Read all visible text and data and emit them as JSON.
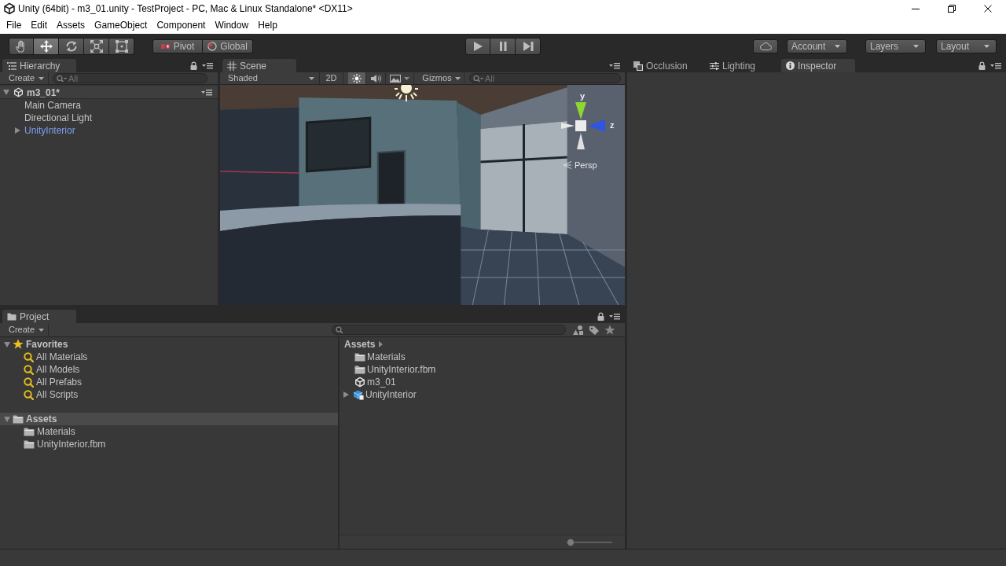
{
  "window": {
    "title": "Unity (64bit) - m3_01.unity - TestProject - PC, Mac & Linux Standalone* <DX11>"
  },
  "menu": [
    "File",
    "Edit",
    "Assets",
    "GameObject",
    "Component",
    "Window",
    "Help"
  ],
  "toolbar": {
    "tools": [
      {
        "kind": "hand",
        "selected": false
      },
      {
        "kind": "move",
        "selected": true
      },
      {
        "kind": "rotate",
        "selected": false
      },
      {
        "kind": "scale",
        "selected": false
      },
      {
        "kind": "rect",
        "selected": false
      }
    ],
    "handle_position": "Pivot",
    "handle_rotation": "Global",
    "playback": [
      {
        "kind": "play"
      },
      {
        "kind": "pause"
      },
      {
        "kind": "step"
      }
    ],
    "account": "Account",
    "layers": "Layers",
    "layout": "Layout"
  },
  "hierarchy": {
    "tab": "Hierarchy",
    "create": "Create",
    "search": {
      "placeholder": "All"
    },
    "scene": {
      "name": "m3_01*",
      "expanded": true,
      "selected": false,
      "children": [
        {
          "name": "Main Camera",
          "kind": "object",
          "selected": false
        },
        {
          "name": "Directional Light",
          "kind": "object",
          "selected": false
        },
        {
          "name": "UnityInterior",
          "kind": "prefab",
          "selected": false,
          "expanded": false
        }
      ]
    }
  },
  "scene_view": {
    "tab": "Scene",
    "draw_mode": "Shaded",
    "toggles": [
      {
        "kind": "flat",
        "label": "2D",
        "on": false
      },
      {
        "kind": "lighting",
        "on": true
      },
      {
        "kind": "audio",
        "on": false
      },
      {
        "kind": "effects",
        "on": false
      }
    ],
    "gizmos": "Gizmos",
    "search": {
      "placeholder": "All"
    },
    "axes": [
      {
        "kind": "up",
        "label": "y"
      },
      {
        "kind": "forward",
        "label": "z"
      }
    ],
    "projection": "Persp"
  },
  "inspector_dock": {
    "tabs": [
      {
        "kind": "occlusion",
        "label": "Occlusion",
        "selected": false
      },
      {
        "kind": "lighting",
        "label": "Lighting",
        "selected": false
      },
      {
        "kind": "inspector",
        "label": "Inspector",
        "selected": true
      }
    ]
  },
  "project": {
    "tab": "Project",
    "create": "Create",
    "tree": [
      {
        "kind": "favorites",
        "name": "Favorites",
        "expanded": true,
        "selected": false,
        "children": [
          {
            "name": "All Materials",
            "selected": false
          },
          {
            "name": "All Models",
            "selected": false
          },
          {
            "name": "All Prefabs",
            "selected": false
          },
          {
            "name": "All Scripts",
            "selected": false
          }
        ]
      },
      {
        "kind": "folder",
        "name": "Assets",
        "expanded": true,
        "selected": true,
        "children": [
          {
            "name": "Materials",
            "selected": false
          },
          {
            "name": "UnityInterior.fbm",
            "selected": false
          }
        ]
      }
    ],
    "breadcrumb": [
      "Assets"
    ],
    "items": [
      {
        "kind": "folder",
        "name": "Materials",
        "selected": false
      },
      {
        "kind": "folder",
        "name": "UnityInterior.fbm",
        "selected": false
      },
      {
        "kind": "scene",
        "name": "m3_01",
        "selected": false
      },
      {
        "kind": "model",
        "name": "UnityInterior",
        "selected": false,
        "expanded": false
      }
    ],
    "icon_size": {
      "level": 0
    }
  }
}
